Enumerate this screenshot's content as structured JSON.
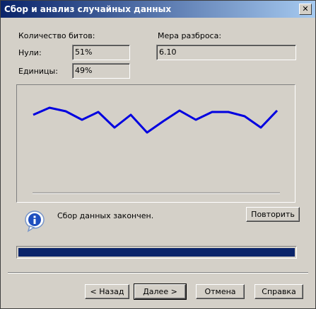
{
  "window": {
    "title": "Сбор и анализ случайных данных",
    "close_glyph": "✕"
  },
  "bits": {
    "heading": "Количество битов:",
    "zeros_label": "Нули:",
    "zeros_value": "51%",
    "ones_label": "Единицы:",
    "ones_value": "49%"
  },
  "spread": {
    "heading": "Мера разброса:",
    "value": "6.10"
  },
  "chart_data": {
    "type": "line",
    "x": [
      1,
      2,
      3,
      4,
      5,
      6,
      7,
      8,
      9,
      10,
      11,
      12,
      13,
      14,
      15,
      16
    ],
    "series": [
      {
        "color": "#0000e0",
        "values": [
          6.8,
          7.8,
          7.3,
          6.1,
          7.2,
          5.0,
          6.8,
          4.3,
          5.9,
          7.4,
          6.1,
          7.2,
          7.2,
          6.6,
          5.0,
          7.4
        ]
      }
    ],
    "ylim": [
      0,
      10
    ],
    "grid": false,
    "title": "",
    "xlabel": "",
    "ylabel": ""
  },
  "status": {
    "icon": "info-icon",
    "message": "Сбор данных закончен.",
    "retry_label": "Повторить"
  },
  "progress": {
    "fraction": 1.0,
    "color": "#0a246a"
  },
  "buttons": {
    "back": "< Назад",
    "next": "Далее >",
    "cancel": "Отмена",
    "help": "Справка"
  }
}
